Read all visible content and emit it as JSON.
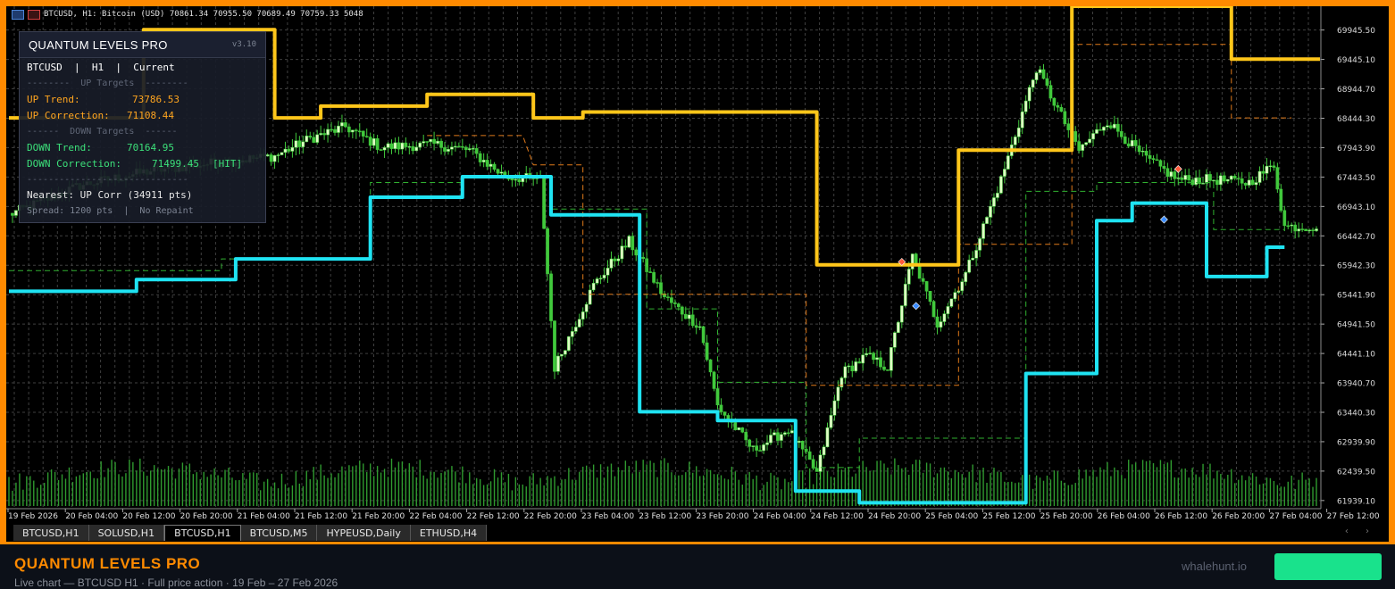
{
  "window": {
    "title": "BTCUSD, H1:  Bitcoin (USD)  70861.34 70955.50 70689.49 70759.33  5048"
  },
  "panel": {
    "title": "QUANTUM LEVELS PRO",
    "version": "v3.10",
    "symbol_line": "BTCUSD  |  H1  |  Current",
    "up_header": "--------  UP Targets  --------",
    "up_trend_label": "UP Trend:",
    "up_trend_value": "73786.53",
    "up_corr_label": "UP Correction:",
    "up_corr_value": "71108.44",
    "down_header": "------  DOWN Targets  ------",
    "down_trend_label": "DOWN Trend:",
    "down_trend_value": "70164.95",
    "down_corr_label": "DOWN Correction:",
    "down_corr_value": "71499.45",
    "down_corr_status": "[HIT]",
    "separator": "------------------------------",
    "nearest": "Nearest: UP Corr (34911 pts)",
    "spread": "Spread: 1200 pts  |  No Repaint"
  },
  "colors": {
    "up": "#ffc61a",
    "down": "#1fe3f2",
    "bull": "#dfffc4",
    "bear": "#41c93c",
    "grid": "#3f3f3f",
    "orange_dash": "#e07a1a",
    "green_dash": "#30b030",
    "frame": "#ff8a00"
  },
  "chart_data": {
    "type": "candlestick",
    "symbol": "BTCUSD",
    "timeframe": "H1",
    "y_ticks": [
      "69945.50",
      "69445.10",
      "68944.70",
      "68444.30",
      "67943.90",
      "67443.50",
      "66943.10",
      "66442.70",
      "65942.30",
      "65441.90",
      "64941.50",
      "64441.10",
      "63940.70",
      "63440.30",
      "62939.90",
      "62439.50",
      "61939.10"
    ],
    "ylim": [
      61800,
      70350
    ],
    "x_ticks": [
      "19 Feb 2026",
      "20 Feb 04:00",
      "20 Feb 12:00",
      "20 Feb 20:00",
      "21 Feb 04:00",
      "21 Feb 12:00",
      "21 Feb 20:00",
      "22 Feb 04:00",
      "22 Feb 12:00",
      "22 Feb 20:00",
      "23 Feb 04:00",
      "23 Feb 12:00",
      "23 Feb 20:00",
      "24 Feb 04:00",
      "24 Feb 12:00",
      "24 Feb 20:00",
      "25 Feb 04:00",
      "25 Feb 12:00",
      "25 Feb 20:00",
      "26 Feb 04:00",
      "26 Feb 12:00",
      "26 Feb 20:00",
      "27 Feb 04:00",
      "27 Feb 12:00"
    ],
    "up_level": [
      [
        0,
        68450
      ],
      [
        38,
        68450
      ],
      [
        38,
        69950
      ],
      [
        75,
        69950
      ],
      [
        75,
        68450
      ],
      [
        88,
        68450
      ],
      [
        88,
        68650
      ],
      [
        118,
        68650
      ],
      [
        118,
        68850
      ],
      [
        148,
        68850
      ],
      [
        148,
        68450
      ],
      [
        162,
        68450
      ],
      [
        162,
        68550
      ],
      [
        228,
        68550
      ],
      [
        228,
        65950
      ],
      [
        268,
        65950
      ],
      [
        268,
        67900
      ],
      [
        300,
        67900
      ],
      [
        300,
        70350
      ],
      [
        345,
        70350
      ],
      [
        345,
        69450
      ],
      [
        370,
        69450
      ]
    ],
    "down_level": [
      [
        0,
        65500
      ],
      [
        36,
        65500
      ],
      [
        36,
        65700
      ],
      [
        64,
        65700
      ],
      [
        64,
        66050
      ],
      [
        102,
        66050
      ],
      [
        102,
        67100
      ],
      [
        128,
        67100
      ],
      [
        128,
        67450
      ],
      [
        153,
        67450
      ],
      [
        153,
        66800
      ],
      [
        178,
        66800
      ],
      [
        178,
        63450
      ],
      [
        200,
        63450
      ],
      [
        200,
        63300
      ],
      [
        222,
        63300
      ],
      [
        222,
        62100
      ],
      [
        240,
        62100
      ],
      [
        240,
        61900
      ],
      [
        287,
        61900
      ],
      [
        287,
        64100
      ],
      [
        307,
        64100
      ],
      [
        307,
        66700
      ],
      [
        317,
        66700
      ],
      [
        317,
        67000
      ],
      [
        338,
        67000
      ],
      [
        338,
        65750
      ],
      [
        355,
        65750
      ],
      [
        355,
        66250
      ],
      [
        360,
        66250
      ]
    ],
    "orange_dash": [
      [
        118,
        68150
      ],
      [
        145,
        68150
      ],
      [
        148,
        67650
      ],
      [
        162,
        67650
      ],
      [
        162,
        65450
      ],
      [
        225,
        65450
      ],
      [
        225,
        63900
      ],
      [
        268,
        63900
      ],
      [
        268,
        66300
      ],
      [
        300,
        66300
      ],
      [
        300,
        69700
      ],
      [
        345,
        69700
      ],
      [
        345,
        68450
      ],
      [
        362,
        68450
      ]
    ],
    "green_dash": [
      [
        0,
        65850
      ],
      [
        60,
        65850
      ],
      [
        60,
        66050
      ],
      [
        102,
        66050
      ],
      [
        102,
        67350
      ],
      [
        128,
        67350
      ],
      [
        128,
        67450
      ],
      [
        153,
        67450
      ],
      [
        153,
        66900
      ],
      [
        180,
        66900
      ],
      [
        180,
        65200
      ],
      [
        200,
        65200
      ],
      [
        200,
        63950
      ],
      [
        225,
        63950
      ],
      [
        225,
        62500
      ],
      [
        240,
        62500
      ],
      [
        240,
        63000
      ],
      [
        287,
        63000
      ],
      [
        287,
        67200
      ],
      [
        307,
        67200
      ],
      [
        307,
        67350
      ],
      [
        340,
        67350
      ],
      [
        340,
        66550
      ],
      [
        360,
        66550
      ]
    ],
    "markers": [
      {
        "i": 252,
        "price": 66000,
        "color": "#ff5a3a"
      },
      {
        "i": 256,
        "price": 65250,
        "color": "#3a8bff"
      },
      {
        "i": 330,
        "price": 67580,
        "color": "#ff5a3a"
      },
      {
        "i": 326,
        "price": 66720,
        "color": "#3a8bff"
      }
    ],
    "anchors": [
      [
        0,
        66800
      ],
      [
        20,
        67300
      ],
      [
        40,
        67550
      ],
      [
        60,
        67700
      ],
      [
        75,
        67800
      ],
      [
        85,
        68100
      ],
      [
        95,
        68300
      ],
      [
        105,
        67950
      ],
      [
        120,
        68000
      ],
      [
        130,
        67900
      ],
      [
        140,
        67450
      ],
      [
        150,
        67400
      ],
      [
        154,
        64200
      ],
      [
        165,
        65600
      ],
      [
        175,
        66350
      ],
      [
        185,
        65400
      ],
      [
        195,
        64900
      ],
      [
        200,
        63550
      ],
      [
        210,
        62800
      ],
      [
        220,
        63150
      ],
      [
        228,
        62400
      ],
      [
        235,
        64100
      ],
      [
        242,
        64400
      ],
      [
        248,
        64200
      ],
      [
        255,
        66100
      ],
      [
        262,
        64950
      ],
      [
        270,
        65800
      ],
      [
        280,
        67400
      ],
      [
        290,
        69300
      ],
      [
        302,
        67900
      ],
      [
        310,
        68400
      ],
      [
        320,
        67800
      ],
      [
        330,
        67400
      ],
      [
        340,
        67400
      ],
      [
        350,
        67350
      ],
      [
        357,
        67650
      ],
      [
        360,
        66600
      ]
    ],
    "volume_level": 0.25
  },
  "tabs": [
    {
      "label": "BTCUSD,H1",
      "active": false
    },
    {
      "label": "SOLUSD,H1",
      "active": false
    },
    {
      "label": "BTCUSD,H1",
      "active": true
    },
    {
      "label": "BTCUSD,M5",
      "active": false
    },
    {
      "label": "HYPEUSD,Daily",
      "active": false
    },
    {
      "label": "ETHUSD,H4",
      "active": false
    }
  ],
  "tab_arrows": "‹ ›",
  "footer": {
    "title": "QUANTUM LEVELS PRO",
    "subtitle": "Live chart — BTCUSD H1 · Full price action · 19 Feb – 27 Feb 2026",
    "brand": "whalehunt.io"
  }
}
